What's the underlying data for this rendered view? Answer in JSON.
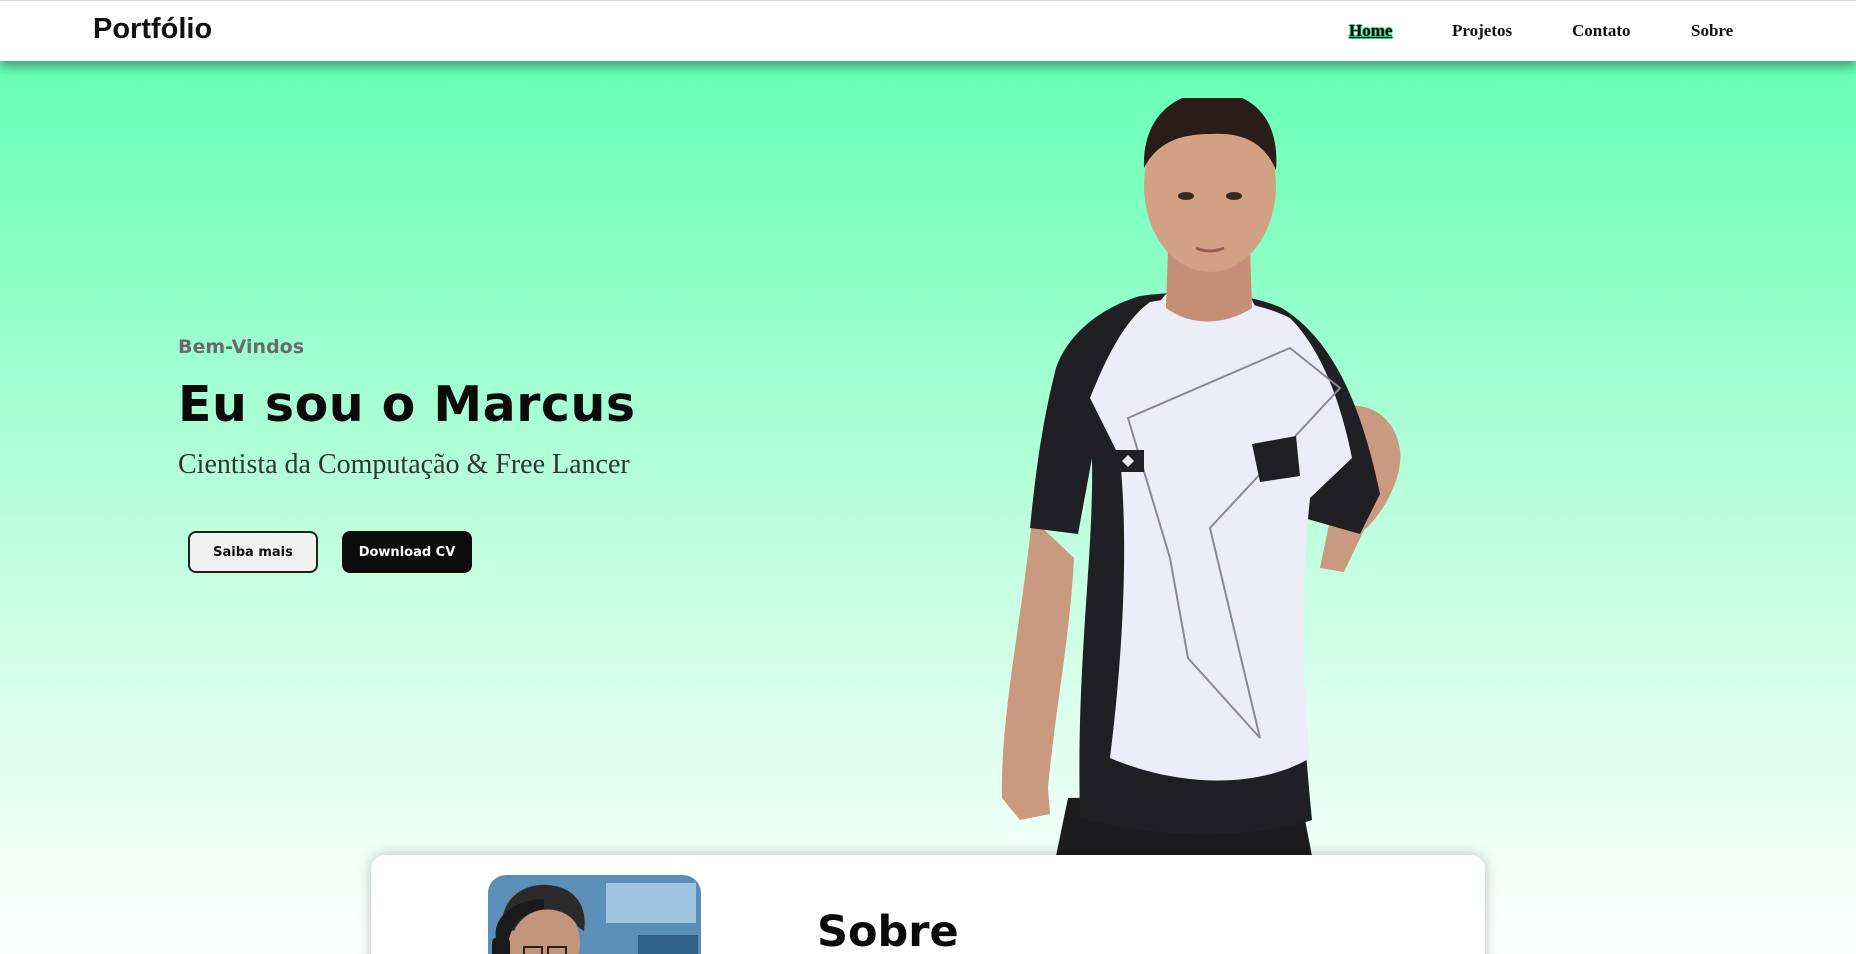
{
  "brand": {
    "logo": "Portfólio"
  },
  "nav": {
    "items": [
      {
        "label": "Home",
        "active": true
      },
      {
        "label": "Projetos",
        "active": false
      },
      {
        "label": "Contato",
        "active": false
      },
      {
        "label": "Sobre",
        "active": false
      }
    ]
  },
  "hero": {
    "welcome": "Bem-Vindos",
    "title": "Eu sou o Marcus",
    "subtitle": "Cientista da Computação & Free Lancer",
    "buttons": {
      "primary": "Saiba mais",
      "secondary": "Download CV"
    }
  },
  "about": {
    "title": "Sobre"
  },
  "colors": {
    "accent_green": "#5dffb2",
    "nav_active_outline": "#27d88a",
    "dark_button": "#0c0c0c",
    "light_button": "#f1f1f1"
  }
}
